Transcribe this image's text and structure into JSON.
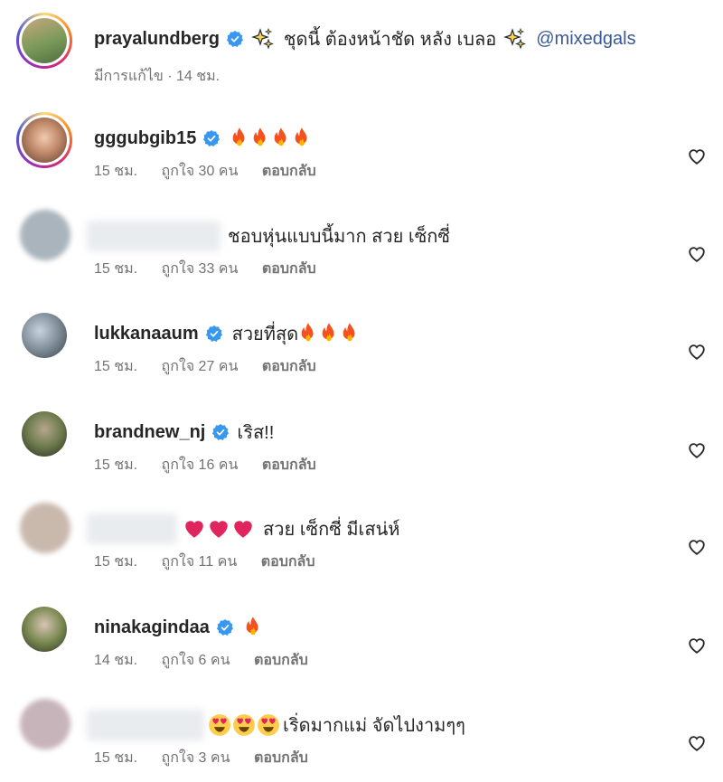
{
  "post": {
    "username": "prayalundberg",
    "caption": "ชุดนี้ ต้องหน้าชัด หลัง เบลอ",
    "mention": "@mixedgals",
    "meta": "มีการแก้ไข · 14 ชม."
  },
  "labels": {
    "likes_prefix": "ถูกใจ",
    "likes_suffix": "คน",
    "reply": "ตอบกลับ"
  },
  "comments": [
    {
      "username": "gggubgib15",
      "verified": true,
      "text": "",
      "emoji": [
        "fire",
        "fire",
        "fire",
        "fire"
      ],
      "time": "15 ชม.",
      "likes": "ถูกใจ 30 คน",
      "reply": "ตอบกลับ"
    },
    {
      "username": "",
      "verified": false,
      "text": "ชอบหุ่นแบบนี้มาก สวย เซ็กซี่",
      "emoji": [],
      "time": "15 ชม.",
      "likes": "ถูกใจ 33 คน",
      "reply": "ตอบกลับ"
    },
    {
      "username": "lukkanaaum",
      "verified": true,
      "text": "สวยที่สุด",
      "emoji": [
        "fire",
        "fire",
        "fire"
      ],
      "time": "15 ชม.",
      "likes": "ถูกใจ 27 คน",
      "reply": "ตอบกลับ"
    },
    {
      "username": "brandnew_nj",
      "verified": true,
      "text": "เริส!!",
      "emoji": [],
      "time": "15 ชม.",
      "likes": "ถูกใจ 16 คน",
      "reply": "ตอบกลับ"
    },
    {
      "username": "",
      "verified": false,
      "text": "สวย เซ็กซี่ มีเสน่ห์",
      "emoji_before": [
        "heart",
        "heart",
        "heart"
      ],
      "time": "15 ชม.",
      "likes": "ถูกใจ 11 คน",
      "reply": "ตอบกลับ"
    },
    {
      "username": "ninakagindaa",
      "verified": true,
      "text": "",
      "emoji": [
        "fire"
      ],
      "time": "14 ชม.",
      "likes": "ถูกใจ 6 คน",
      "reply": "ตอบกลับ"
    },
    {
      "username": "",
      "verified": false,
      "text": "เริ่ดมากแม่ จัดไปงามๆๆ",
      "emoji_before": [
        "heart-eyes",
        "heart-eyes",
        "heart-eyes"
      ],
      "time": "15 ชม.",
      "likes": "ถูกใจ 3 คน",
      "reply": "ตอบกลับ"
    }
  ],
  "colors": {
    "verified": "#3897f0",
    "meta": "#737373",
    "mention": "#385898",
    "fire": "#f4511e",
    "heart": "#e0245e"
  }
}
